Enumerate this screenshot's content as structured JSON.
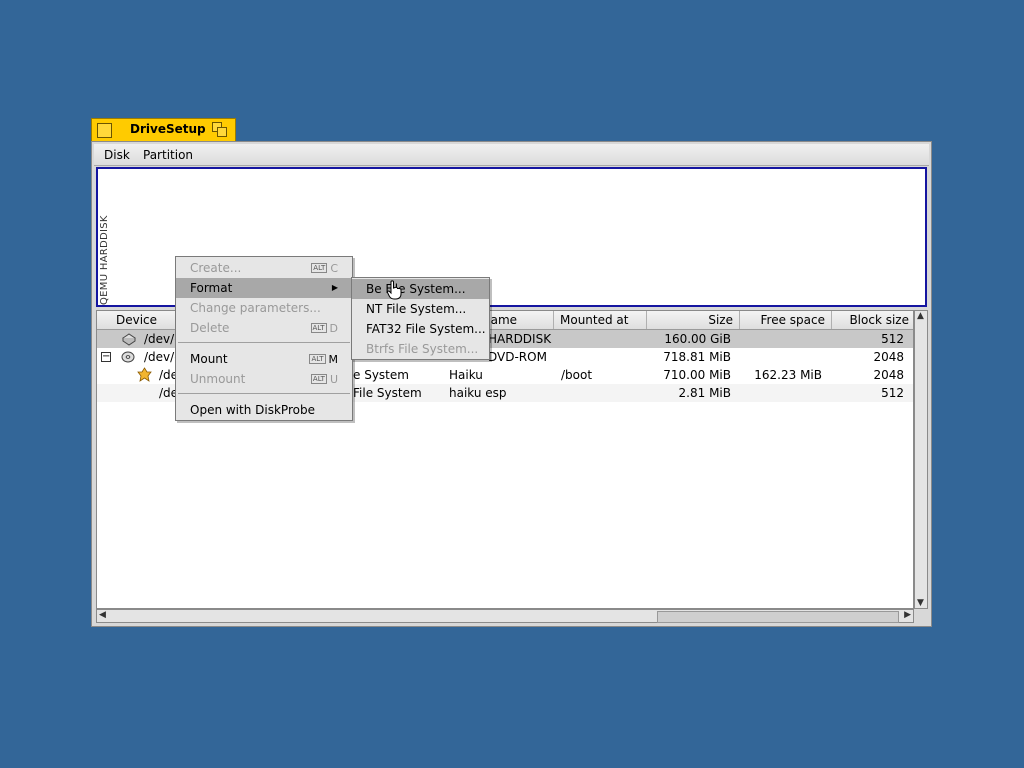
{
  "window": {
    "title": "DriveSetup",
    "menus": [
      "Disk",
      "Partition"
    ],
    "disk_label": "QEMU HARDDISK"
  },
  "table": {
    "columns": [
      "Device",
      "Volume name",
      "Mounted at",
      "Size",
      "Free space",
      "Block size"
    ],
    "rows": [
      {
        "device": "/dev/disk/ata/0/master/raw",
        "fs": "",
        "volume": "QEMU HARDDISK",
        "mounted": "",
        "size": "160.00 GiB",
        "free": "",
        "block": "512"
      },
      {
        "device": "/dev/disk/atapi/1/master/raw",
        "fs": "",
        "volume": "QEMU DVD-ROM",
        "mounted": "",
        "size": "718.81 MiB",
        "free": "",
        "block": "2048"
      },
      {
        "device": "/dev/disk/atapi/1/master/0",
        "fs": "Be File System",
        "volume": "Haiku",
        "mounted": "/boot",
        "size": "710.00 MiB",
        "free": "162.23 MiB",
        "block": "2048"
      },
      {
        "device": "/dev/disk/atapi/1/master/1",
        "fs": "FAT32 File System",
        "volume": "haiku esp",
        "mounted": "",
        "size": "2.81 MiB",
        "free": "",
        "block": "512"
      }
    ],
    "visible_cells": {
      "r0_device": "/dev/d",
      "r1_device": "/dev/d",
      "r2_device": "/de",
      "r3_device": "/de",
      "r0_volume": "HARDDISK",
      "r1_volume": "DVD-ROM",
      "r2_fs": "e System",
      "r3_fs": "File System",
      "col_volume_partial": "name",
      "r1_volume_prefix": "Q"
    }
  },
  "context_menu": {
    "items": [
      {
        "label": "Create...",
        "shortcut": "C",
        "mod": "ALT",
        "enabled": false
      },
      {
        "label": "Format",
        "submenu": true,
        "enabled": true,
        "highlighted": true
      },
      {
        "label": "Change parameters...",
        "enabled": false
      },
      {
        "label": "Delete",
        "shortcut": "D",
        "mod": "ALT",
        "enabled": false
      },
      {
        "label": "Mount",
        "shortcut": "M",
        "mod": "ALT",
        "enabled": true
      },
      {
        "label": "Unmount",
        "shortcut": "U",
        "mod": "ALT",
        "enabled": false
      },
      {
        "label": "Open with DiskProbe",
        "enabled": true
      }
    ]
  },
  "format_submenu": {
    "items": [
      {
        "label": "Be File System...",
        "enabled": true,
        "highlighted": true
      },
      {
        "label": "NT File System...",
        "enabled": true
      },
      {
        "label": "FAT32 File System...",
        "enabled": true
      },
      {
        "label": "Btrfs File System...",
        "enabled": false
      }
    ]
  },
  "colors": {
    "desktop": "#336698",
    "tab": "#ffcb00",
    "disk_border": "#1515a0",
    "selection": "#c8c8c8"
  }
}
